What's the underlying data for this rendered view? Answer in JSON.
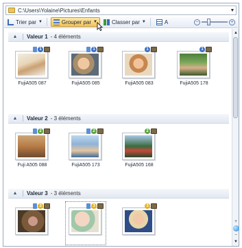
{
  "address": {
    "path": "C:\\Users\\Yolaine\\Pictures\\Enfants"
  },
  "toolbar": {
    "sort_label": "Trier par",
    "group_label": "Grouper par",
    "arrange_label": "Classer par",
    "view_label": "A"
  },
  "groups": [
    {
      "title": "Valeur 1",
      "count": "- 4 éléments",
      "items": [
        {
          "caption": "FujiA505 087",
          "badge_number": "1",
          "badge_color": "#3c6fc4"
        },
        {
          "caption": "FujiA505 085",
          "badge_number": "1",
          "badge_color": "#3c6fc4"
        },
        {
          "caption": "FujiA505 083",
          "badge_number": "1",
          "badge_color": "#3c6fc4"
        },
        {
          "caption": "FujiA505 178",
          "badge_number": "1",
          "badge_color": "#3c6fc4"
        }
      ]
    },
    {
      "title": "Valeur 2",
      "count": "- 3 éléments",
      "items": [
        {
          "caption": "Fuji A505 088",
          "badge_number": "2",
          "badge_color": "#5aa53a"
        },
        {
          "caption": "FujiA505 173",
          "badge_number": "2",
          "badge_color": "#5aa53a"
        },
        {
          "caption": "FujiA505 168",
          "badge_number": "2",
          "badge_color": "#5aa53a"
        }
      ]
    },
    {
      "title": "Valeur 3",
      "count": "- 3 éléments",
      "items": [
        {
          "caption": "",
          "badge_number": "3",
          "badge_color": "#e3b21c"
        },
        {
          "caption": "",
          "badge_number": "3",
          "badge_color": "#e3b21c"
        },
        {
          "caption": "",
          "badge_number": "3",
          "badge_color": "#e3b21c"
        }
      ]
    }
  ]
}
